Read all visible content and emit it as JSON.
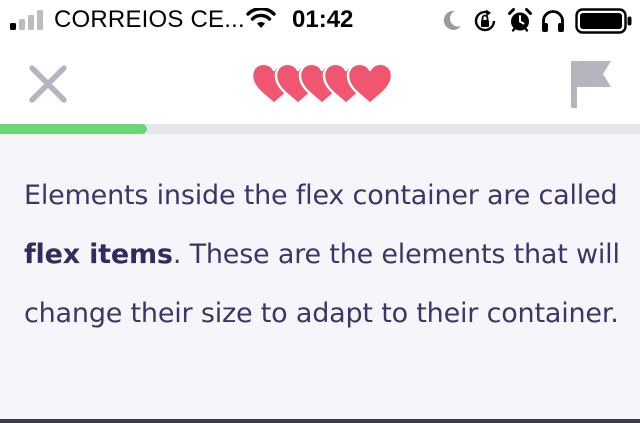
{
  "status_bar": {
    "carrier": "CORREIOS CE...",
    "time": "01:42",
    "icons": [
      "signal-icon",
      "wifi-icon",
      "moon-icon",
      "rotation-lock-icon",
      "alarm-icon",
      "headphones-icon",
      "battery-icon"
    ]
  },
  "header": {
    "close_icon": "close-icon",
    "lives_count": 5,
    "lives_icon": "heart-icon",
    "report_icon": "flag-icon"
  },
  "progress": {
    "fraction": 0.23
  },
  "lesson": {
    "text_before": "Elements inside the flex container are called ",
    "text_bold": "flex items",
    "text_after": ". These are the elements that will change their size to adapt to their container."
  },
  "colors": {
    "heart": "#f0566f",
    "progress": "#68d774",
    "text": "#3a3768",
    "icon_gray": "#b5b5bd",
    "content_bg": "#f6f6fa"
  }
}
